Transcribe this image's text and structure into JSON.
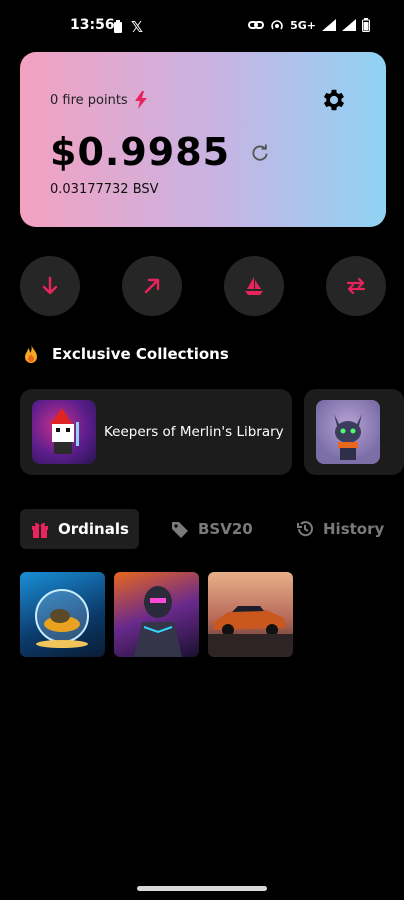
{
  "status_bar": {
    "time": "13:56",
    "x_icon": "𝕏",
    "network": "5G+"
  },
  "wallet": {
    "fire_points_label": "0 fire points",
    "balance_usd": "$0.9985",
    "balance_bsv": "0.03177732 BSV",
    "accent": "#e8245c"
  },
  "actions": [
    {
      "icon": "receive-arrow-down-icon"
    },
    {
      "icon": "send-arrow-up-right-icon"
    },
    {
      "icon": "sailboat-icon"
    },
    {
      "icon": "swap-arrows-icon"
    }
  ],
  "collections": {
    "title": "Exclusive Collections",
    "items": [
      {
        "name": "Keepers of Merlin's Library"
      },
      {
        "name": ""
      }
    ]
  },
  "tabs": [
    {
      "label": "Ordinals",
      "active": true
    },
    {
      "label": "BSV20",
      "active": false
    },
    {
      "label": "History",
      "active": false
    }
  ],
  "ordinals": [
    {
      "id": "ordinal-1"
    },
    {
      "id": "ordinal-2"
    },
    {
      "id": "ordinal-3"
    }
  ]
}
